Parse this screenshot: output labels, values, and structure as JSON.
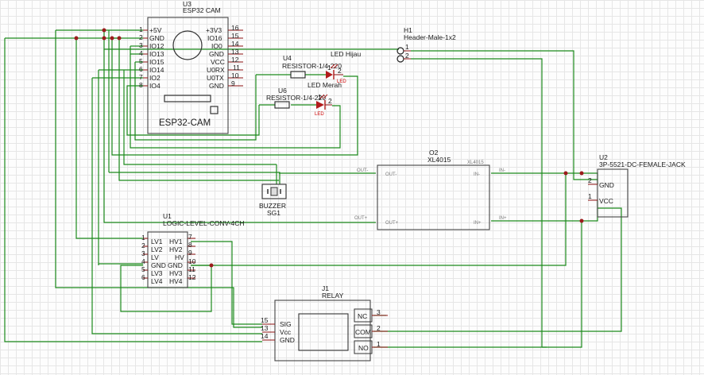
{
  "esp32": {
    "ref": "U3",
    "name": "ESP32 CAM",
    "label": "ESP32-CAM",
    "left_pins": [
      {
        "num": "1",
        "name": "+5V"
      },
      {
        "num": "2",
        "name": "GND"
      },
      {
        "num": "3",
        "name": "IO12"
      },
      {
        "num": "4",
        "name": "IO13"
      },
      {
        "num": "5",
        "name": "IO15"
      },
      {
        "num": "6",
        "name": "IO14"
      },
      {
        "num": "7",
        "name": "IO2"
      },
      {
        "num": "8",
        "name": "IO4"
      }
    ],
    "right_pins": [
      {
        "num": "16",
        "name": "+3V3"
      },
      {
        "num": "15",
        "name": "IO16"
      },
      {
        "num": "14",
        "name": "IO0"
      },
      {
        "num": "13",
        "name": "GND"
      },
      {
        "num": "12",
        "name": "VCC"
      },
      {
        "num": "11",
        "name": "U0RX"
      },
      {
        "num": "10",
        "name": "U0TX"
      },
      {
        "num": "9",
        "name": "GND"
      }
    ]
  },
  "header": {
    "ref": "H1",
    "name": "Header-Male-1x2",
    "pins": [
      "1",
      "2"
    ]
  },
  "r4": {
    "ref": "U4",
    "name": "RESISTOR-1/4-220"
  },
  "r6": {
    "ref": "U6",
    "name": "RESISTOR-1/4-220"
  },
  "led_green": {
    "name": "LED Hijau",
    "tag": "LED",
    "pins": [
      "1",
      "2"
    ]
  },
  "led_red": {
    "name": "LED Merah",
    "tag": "LED",
    "pins": [
      "1",
      "2"
    ]
  },
  "buzzer": {
    "name": "BUZZER",
    "ref": "SG1"
  },
  "xl4015": {
    "ref": "O2",
    "name": "XL4015",
    "tag": "XL4015",
    "pins": {
      "out_minus": "OUT-",
      "out_plus": "OUT+",
      "in_minus": "IN-",
      "in_plus": "IN+"
    },
    "net_labels": {
      "out_minus": "OUT-",
      "out_plus": "OUT+",
      "in_minus": "IN-",
      "in_plus": "IN+"
    }
  },
  "jack": {
    "ref": "U2",
    "name": "3P-5521-DC-FEMALE-JACK",
    "pins": [
      {
        "num": "2",
        "name": "GND"
      },
      {
        "num": "1",
        "name": "VCC"
      }
    ]
  },
  "llc": {
    "ref": "U1",
    "name": "LOGIC-LEVEL-CONV-4CH",
    "left_pins": [
      {
        "num": "1",
        "name": "LV1"
      },
      {
        "num": "2",
        "name": "LV2"
      },
      {
        "num": "3",
        "name": "LV"
      },
      {
        "num": "4",
        "name": "GND"
      },
      {
        "num": "5",
        "name": "LV3"
      },
      {
        "num": "6",
        "name": "LV4"
      }
    ],
    "right_pins": [
      {
        "num": "7",
        "name": "HV1"
      },
      {
        "num": "8",
        "name": "HV2"
      },
      {
        "num": "9",
        "name": "HV"
      },
      {
        "num": "10",
        "name": "GND"
      },
      {
        "num": "11",
        "name": "HV3"
      },
      {
        "num": "12",
        "name": "HV4"
      }
    ]
  },
  "relay": {
    "ref": "J1",
    "name": "RELAY",
    "left_pins": [
      {
        "num": "15",
        "name": "SIG"
      },
      {
        "num": "13",
        "name": "Vcc"
      },
      {
        "num": "14",
        "name": "GND"
      }
    ],
    "right_pins": [
      {
        "num": "3",
        "name": "NC"
      },
      {
        "num": "2",
        "name": "COM"
      },
      {
        "num": "1",
        "name": "NO"
      }
    ]
  }
}
